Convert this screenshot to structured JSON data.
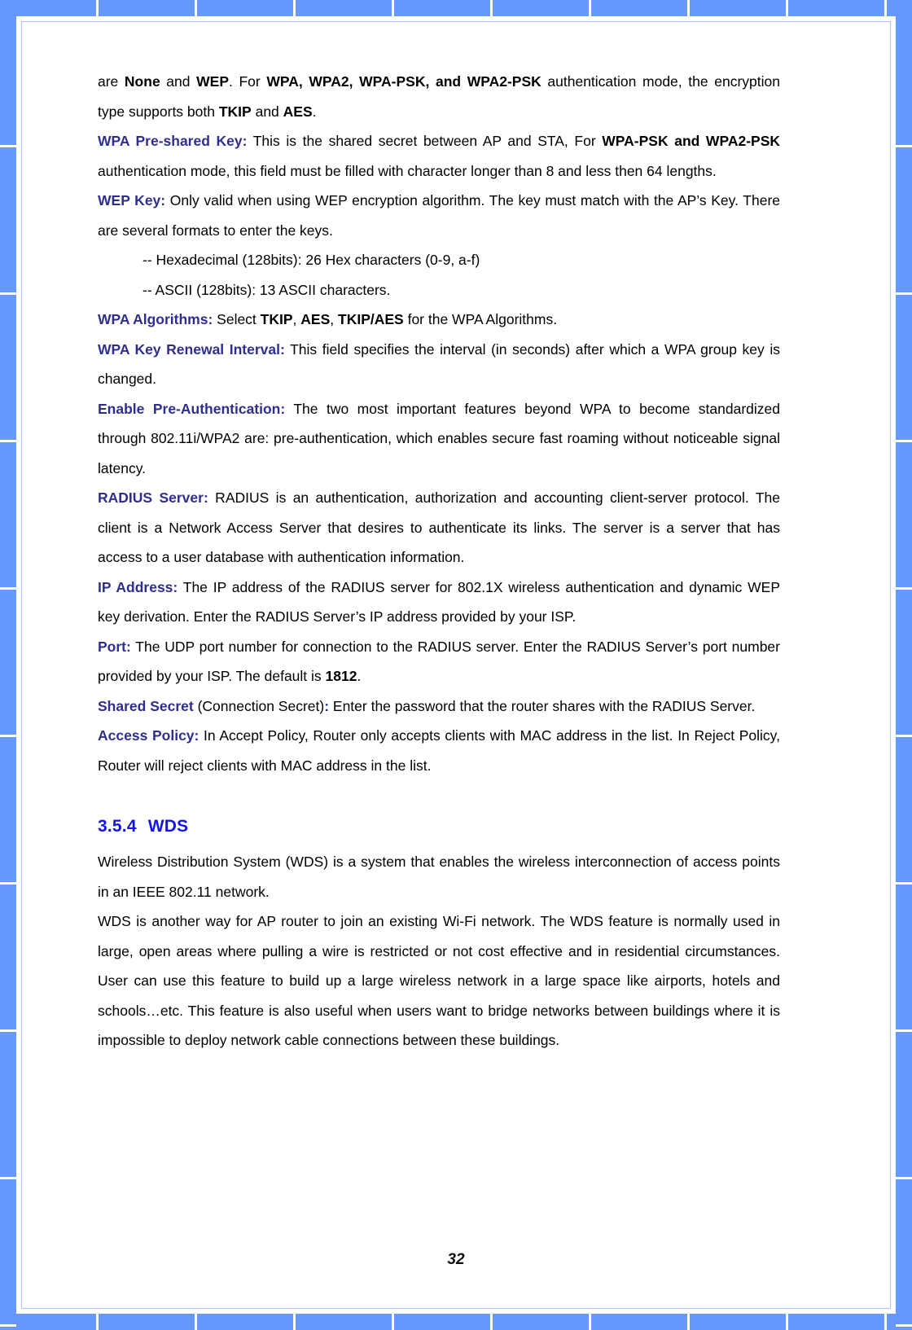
{
  "document": {
    "page_number": "32",
    "border_color": "#6699ff",
    "inner_rule_color": "#aac4f5",
    "label_color": "#2e2e8f",
    "heading_color": "#1414e6",
    "body_color": "#000000"
  },
  "body": {
    "paragraphs": [
      {
        "id": "encryption-type",
        "runs": [
          {
            "text": "are ",
            "style": "normal"
          },
          {
            "text": "None",
            "style": "bold"
          },
          {
            "text": " and ",
            "style": "normal"
          },
          {
            "text": "WEP",
            "style": "bold"
          },
          {
            "text": ". For ",
            "style": "normal"
          },
          {
            "text": "WPA, WPA2, WPA-PSK, and WPA2-PSK",
            "style": "bold"
          },
          {
            "text": " authentication mode, the encryption type supports both ",
            "style": "normal"
          },
          {
            "text": "TKIP",
            "style": "bold"
          },
          {
            "text": " and ",
            "style": "normal"
          },
          {
            "text": "AES",
            "style": "bold"
          },
          {
            "text": ".",
            "style": "normal"
          }
        ]
      },
      {
        "id": "wpa-pre-shared-key",
        "runs": [
          {
            "text": "WPA Pre-shared Key:",
            "style": "label"
          },
          {
            "text": " This is the shared secret between AP and STA, For ",
            "style": "normal"
          },
          {
            "text": "WPA-PSK and WPA2-PSK",
            "style": "bold"
          },
          {
            "text": " authentication mode, this field must be filled with character longer than 8 and less then 64 lengths.",
            "style": "normal"
          }
        ]
      },
      {
        "id": "wep-key",
        "runs": [
          {
            "text": "WEP Key:",
            "style": "label"
          },
          {
            "text": " Only valid when using WEP encryption algorithm. The key must match with the AP’s Key. There are several formats to enter the keys.",
            "style": "normal"
          }
        ]
      }
    ],
    "key_format_items": [
      "-- Hexadecimal (128bits): 26 Hex characters (0-9, a-f)",
      "-- ASCII (128bits): 13 ASCII characters."
    ],
    "paragraphs_2": [
      {
        "id": "wpa-algorithms",
        "runs": [
          {
            "text": "WPA Algorithms:",
            "style": "label"
          },
          {
            "text": " Select ",
            "style": "normal"
          },
          {
            "text": "TKIP",
            "style": "bold"
          },
          {
            "text": ", ",
            "style": "normal"
          },
          {
            "text": "AES",
            "style": "bold"
          },
          {
            "text": ", ",
            "style": "normal"
          },
          {
            "text": "TKIP/AES",
            "style": "bold"
          },
          {
            "text": " for the WPA Algorithms.",
            "style": "normal"
          }
        ]
      },
      {
        "id": "wpa-key-renewal-interval",
        "runs": [
          {
            "text": "WPA Key Renewal Interval:",
            "style": "label"
          },
          {
            "text": " This field specifies the interval (in seconds) after which a WPA group key is changed.",
            "style": "normal"
          }
        ]
      },
      {
        "id": "enable-pre-authentication",
        "runs": [
          {
            "text": "Enable Pre-Authentication:",
            "style": "label"
          },
          {
            "text": " The two most important features beyond WPA to become standardized through 802.11i/WPA2 are: pre-authentication, which enables secure fast roaming without noticeable signal latency.",
            "style": "normal"
          }
        ]
      },
      {
        "id": "radius-server",
        "runs": [
          {
            "text": "RADIUS Server:",
            "style": "label"
          },
          {
            "text": " RADIUS is an authentication, authorization and accounting client-server protocol. The client is a Network Access Server that desires to authenticate its links. The server is a server that has access to a user database with authentication information.",
            "style": "normal"
          }
        ]
      },
      {
        "id": "ip-address",
        "runs": [
          {
            "text": "IP Address:",
            "style": "label"
          },
          {
            "text": " The IP address of the RADIUS server for 802.1X wireless authentication and dynamic WEP key derivation. Enter the RADIUS Server’s IP address provided by your ISP.",
            "style": "normal"
          }
        ]
      },
      {
        "id": "port",
        "runs": [
          {
            "text": "Port:",
            "style": "label"
          },
          {
            "text": " The UDP port number for connection to the RADIUS server. Enter the RADIUS Server’s port number provided by your ISP. The default is ",
            "style": "normal"
          },
          {
            "text": "1812",
            "style": "bold"
          },
          {
            "text": ".",
            "style": "normal"
          }
        ]
      },
      {
        "id": "shared-secret",
        "runs": [
          {
            "text": "Shared Secret",
            "style": "label"
          },
          {
            "text": " (Connection Secret)",
            "style": "normal"
          },
          {
            "text": ":",
            "style": "label"
          },
          {
            "text": " Enter the password that the router shares with the RADIUS Server.",
            "style": "normal"
          }
        ]
      },
      {
        "id": "access-policy",
        "runs": [
          {
            "text": "Access Policy:",
            "style": "label"
          },
          {
            "text": " In Accept Policy, Router only accepts clients with MAC address in the list. In Reject Policy, Router will reject clients with MAC address in the list.",
            "style": "normal"
          }
        ]
      }
    ],
    "section": {
      "number": "3.5.4",
      "title": "WDS"
    },
    "paragraphs_3": [
      {
        "id": "wds-intro",
        "runs": [
          {
            "text": "Wireless Distribution System (WDS) is a system that enables the wireless interconnection of access points in an IEEE 802.11 network.",
            "style": "normal"
          }
        ]
      },
      {
        "id": "wds-detail",
        "runs": [
          {
            "text": "WDS is another way for AP router to join an existing Wi-Fi network. The WDS feature is normally used in large, open areas where pulling a wire is restricted or not cost effective and in residential circumstances. User can use this feature to build up a large wireless network in a large space like airports, hotels and schools…etc. This feature is also useful when users want to bridge networks between buildings where it is impossible to deploy network cable connections between these buildings.",
            "style": "normal"
          }
        ]
      }
    ]
  }
}
